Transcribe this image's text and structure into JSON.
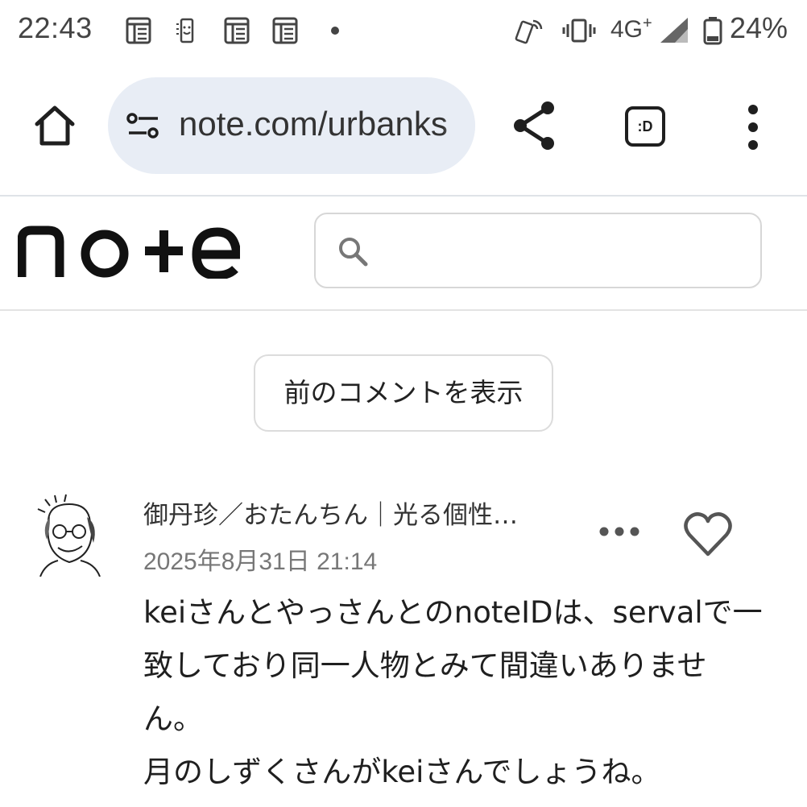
{
  "status_bar": {
    "time": "22:43",
    "network": "4G",
    "network_plus": "+",
    "battery": "24%",
    "icons": [
      "news-icon",
      "phone-vibrate-icon",
      "news-icon",
      "news-icon",
      "dot-icon",
      "hotspot-phone-icon",
      "vibrate-icon",
      "signal-icon",
      "battery-icon"
    ]
  },
  "browser": {
    "url": "note.com/urbanks",
    "tab_badge": ":D",
    "icons": [
      "home-icon",
      "site-settings-icon",
      "share-icon",
      "tab-switcher-icon",
      "more-vert-icon"
    ]
  },
  "header": {
    "logo": "note",
    "search_placeholder": ""
  },
  "prev_comments_label": "前のコメントを表示",
  "comment": {
    "author": "御丹珍／おたんちん｜光る個性…",
    "date": "2025年8月31日 21:14",
    "body_lines": [
      "keiさんとやっさんとのnoteIDは、servalで一",
      "致しており同一人物とみて間違いありませ",
      "ん。",
      "月のしずくさんがkeiさんでしょうね。"
    ]
  },
  "colors": {
    "url_pill": "#e8edf5",
    "text": "#1f1f1f",
    "muted": "#777777",
    "border": "#dcdcdc"
  }
}
